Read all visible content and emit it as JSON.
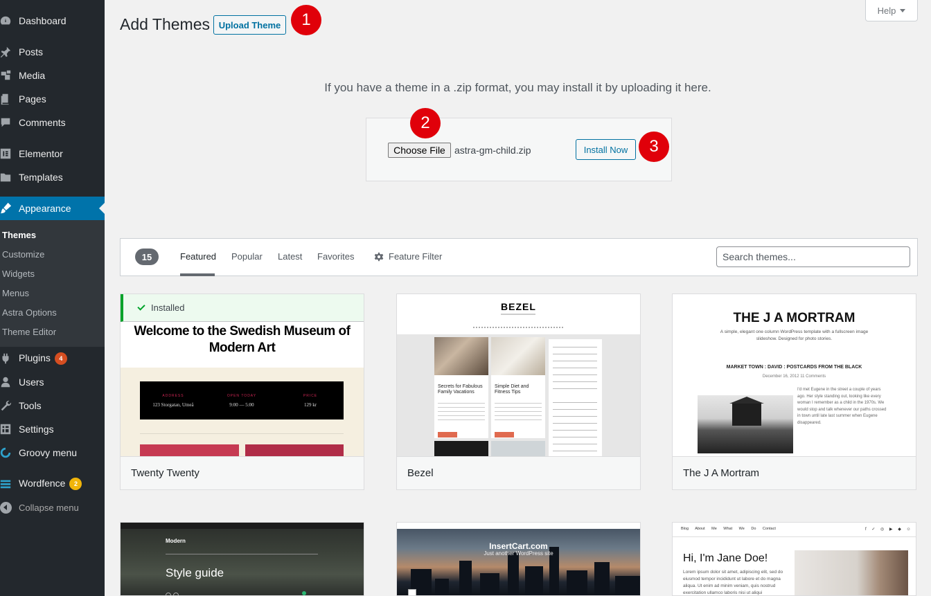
{
  "sidebar": {
    "items": [
      {
        "label": "Dashboard",
        "icon": "dashboard-icon"
      },
      {
        "label": "Posts",
        "icon": "pin-icon"
      },
      {
        "label": "Media",
        "icon": "media-icon"
      },
      {
        "label": "Pages",
        "icon": "pages-icon"
      },
      {
        "label": "Comments",
        "icon": "comment-icon"
      },
      {
        "label": "Elementor",
        "icon": "elementor-icon"
      },
      {
        "label": "Templates",
        "icon": "folder-icon"
      },
      {
        "label": "Appearance",
        "icon": "brush-icon"
      },
      {
        "label": "Plugins",
        "icon": "plug-icon",
        "badge": "4"
      },
      {
        "label": "Users",
        "icon": "user-icon"
      },
      {
        "label": "Tools",
        "icon": "wrench-icon"
      },
      {
        "label": "Settings",
        "icon": "settings-icon"
      },
      {
        "label": "Groovy menu",
        "icon": "groovy-icon"
      },
      {
        "label": "Wordfence",
        "icon": "wordfence-icon",
        "badge": "2"
      }
    ],
    "appearance_submenu": [
      "Themes",
      "Customize",
      "Widgets",
      "Menus",
      "Astra Options",
      "Theme Editor"
    ],
    "collapse_label": "Collapse menu",
    "active_color": "#0073aa",
    "background": "#23282d"
  },
  "header": {
    "title": "Add Themes",
    "upload_button": "Upload Theme",
    "help": "Help"
  },
  "callouts": [
    "1",
    "2",
    "3"
  ],
  "upload": {
    "help_text": "If you have a theme in a .zip format, you may install it by uploading it here.",
    "choose_file": "Choose File",
    "file_name": "astra-gm-child.zip",
    "install_button": "Install Now"
  },
  "filter": {
    "count": "15",
    "tabs": [
      "Featured",
      "Popular",
      "Latest",
      "Favorites"
    ],
    "current_tab": "Featured",
    "feature_filter": "Feature Filter",
    "search_placeholder": "Search themes..."
  },
  "themes": [
    {
      "name": "Twenty Twenty",
      "installed_label": "Installed",
      "preview_heading": "Welcome to the Swedish Museum of Modern Art",
      "preview_cells": [
        {
          "label": "ADDRESS",
          "value": "123 Storgatan, Umeå"
        },
        {
          "label": "OPEN TODAY",
          "value": "9:00 — 5:00"
        },
        {
          "label": "PRICE",
          "value": "129 kr"
        }
      ]
    },
    {
      "name": "Bezel",
      "preview_title": "BEZEL",
      "preview_posts": [
        "Secrets for Fabulous Family Vacations",
        "Simple Diet and Fitness Tips"
      ]
    },
    {
      "name": "The J A Mortram",
      "preview_title": "THE J A MORTRAM",
      "preview_subtitle": "A simple, elegant one column WordPress template with a fullscreen image slideshow. Designed for photo stories.",
      "preview_post_title": "MARKET TOWN : DAVID : POSTCARDS FROM THE BLACK",
      "preview_date": "December 16, 2012 11 Comments",
      "preview_text": "I'd met Eugene in the street a couple of years ago. Her style standing out, looking like every woman I remember as a child in the 1970s. We would stop and talk whenever our paths crossed in town until late last summer when Eugene disappeared."
    },
    {
      "preview_brand": "Modern",
      "preview_title": "Style guide"
    },
    {
      "preview_title": "InsertCart.com",
      "preview_subtitle": "Just another WordPress site"
    },
    {
      "preview_nav": "Blog About Me What We Do Contact",
      "preview_title": "Hi, I'm Jane Doe!",
      "preview_text": "Lorem ipsum dolor sit amet, adipiscing elit, sed do eiusmod tempor incididunt ut labore et do magna aliqua. Ut enim ad minim veniam, quis nostrud exercitation ullamco laboris nisi ut aliqui"
    }
  ]
}
